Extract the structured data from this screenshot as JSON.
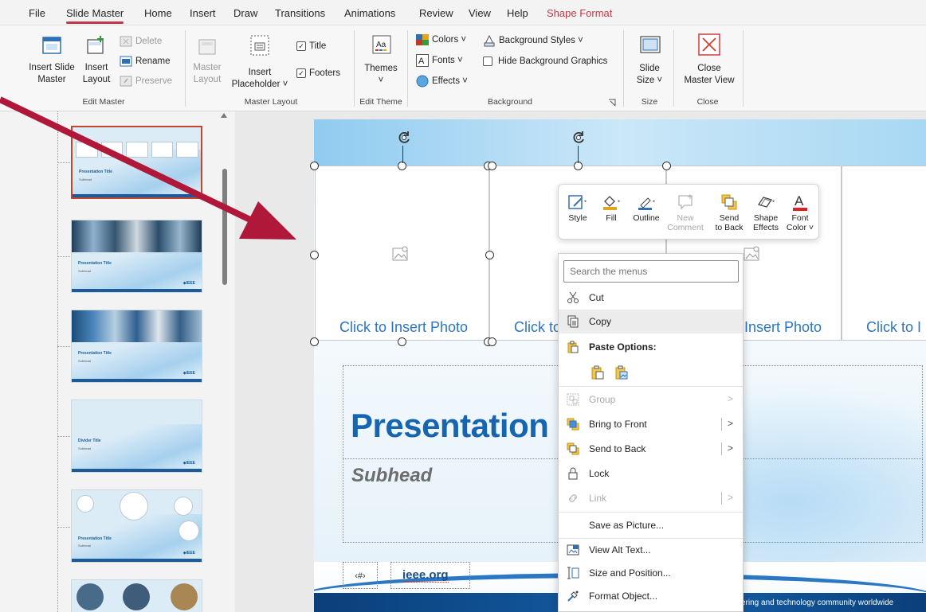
{
  "menu_tabs": [
    "File",
    "Slide Master",
    "Home",
    "Insert",
    "Draw",
    "Transitions",
    "Animations",
    "Review",
    "View",
    "Help",
    "Shape Format"
  ],
  "ribbon": {
    "edit_master": {
      "insert_slide_master": [
        "Insert Slide",
        "Master"
      ],
      "insert_layout": [
        "Insert",
        "Layout"
      ],
      "delete": "Delete",
      "rename": "Rename",
      "preserve": "Preserve",
      "group_label": "Edit Master"
    },
    "master_layout": {
      "master_layout": [
        "Master",
        "Layout"
      ],
      "insert_placeholder": [
        "Insert",
        "Placeholder ˅"
      ],
      "title": "Title",
      "footers": "Footers",
      "group_label": "Master Layout"
    },
    "edit_theme": {
      "themes": "Themes",
      "group_label": "Edit Theme"
    },
    "background": {
      "colors": "Colors ˅",
      "fonts": "Fonts ˅",
      "effects": "Effects ˅",
      "background_styles": "Background Styles ˅",
      "hide_background_graphics": "Hide Background Graphics",
      "group_label": "Background"
    },
    "size": {
      "slide_size": [
        "Slide",
        "Size ˅"
      ],
      "group_label": "Size"
    },
    "close": {
      "close_master_view": [
        "Close",
        "Master View"
      ],
      "group_label": "Close"
    }
  },
  "thumbnails": [
    {
      "title": "Presentation Title",
      "subhead": "Subhead",
      "selected": true
    },
    {
      "title": "Presentation Title",
      "subhead": "Subhead",
      "selected": false
    },
    {
      "title": "Presentation Title",
      "subhead": "Subhead",
      "selected": false
    },
    {
      "title": "Divider Title",
      "subhead": "Subhead",
      "selected": false
    },
    {
      "title": "Presentation Title",
      "subhead": "Subhead",
      "selected": false
    }
  ],
  "slide": {
    "photo_placeholders": [
      "Click to Insert Photo",
      "Click to",
      "Insert Photo",
      "Click to I"
    ],
    "title": "Presentation",
    "subhead": "Subhead",
    "slide_number": "‹#›",
    "site": "ieee.org",
    "tagline": "ering and technology community worldwide"
  },
  "mini_toolbar": [
    {
      "label": [
        "Style",
        ""
      ],
      "icon": "style-icon",
      "enabled": true
    },
    {
      "label": [
        "Fill",
        ""
      ],
      "icon": "fill-icon",
      "enabled": true
    },
    {
      "label": [
        "Outline",
        ""
      ],
      "icon": "outline-icon",
      "enabled": true
    },
    {
      "label": [
        "New",
        "Comment"
      ],
      "icon": "comment-icon",
      "enabled": false
    },
    {
      "label": [
        "Send",
        "to Back"
      ],
      "icon": "send-to-back-icon",
      "enabled": true
    },
    {
      "label": [
        "Shape",
        "Effects"
      ],
      "icon": "shape-effects-icon",
      "enabled": true
    },
    {
      "label": [
        "Font",
        "Color ˅"
      ],
      "icon": "font-color-icon",
      "enabled": true
    }
  ],
  "context_menu": {
    "search_placeholder": "Search the menus",
    "items": [
      {
        "label": "Cut",
        "icon": "scissors-icon",
        "enabled": true
      },
      {
        "label": "Copy",
        "icon": "copy-icon",
        "enabled": true,
        "highlighted": true
      },
      {
        "label": "Paste Options:",
        "icon": "paste-icon",
        "enabled": true
      },
      {
        "label": "Group",
        "icon": "group-icon",
        "enabled": false,
        "submenu": true
      },
      {
        "label": "Bring to Front",
        "icon": "bring-to-front-icon",
        "enabled": true,
        "submenu": true
      },
      {
        "label": "Send to Back",
        "icon": "send-to-back-icon",
        "enabled": true,
        "submenu": true
      },
      {
        "label": "Lock",
        "icon": "lock-icon",
        "enabled": true
      },
      {
        "label": "Link",
        "icon": "link-icon",
        "enabled": false,
        "submenu": true
      },
      {
        "label": "Save as Picture...",
        "icon": "",
        "enabled": true
      },
      {
        "label": "View Alt Text...",
        "icon": "alt-text-icon",
        "enabled": true
      },
      {
        "label": "Size and Position...",
        "icon": "size-position-icon",
        "enabled": true
      },
      {
        "label": "Format Object...",
        "icon": "format-object-icon",
        "enabled": true
      }
    ]
  },
  "colors": {
    "accent": "#c2384a",
    "title_blue": "#1565b0",
    "arrow_red": "#b0183a"
  }
}
